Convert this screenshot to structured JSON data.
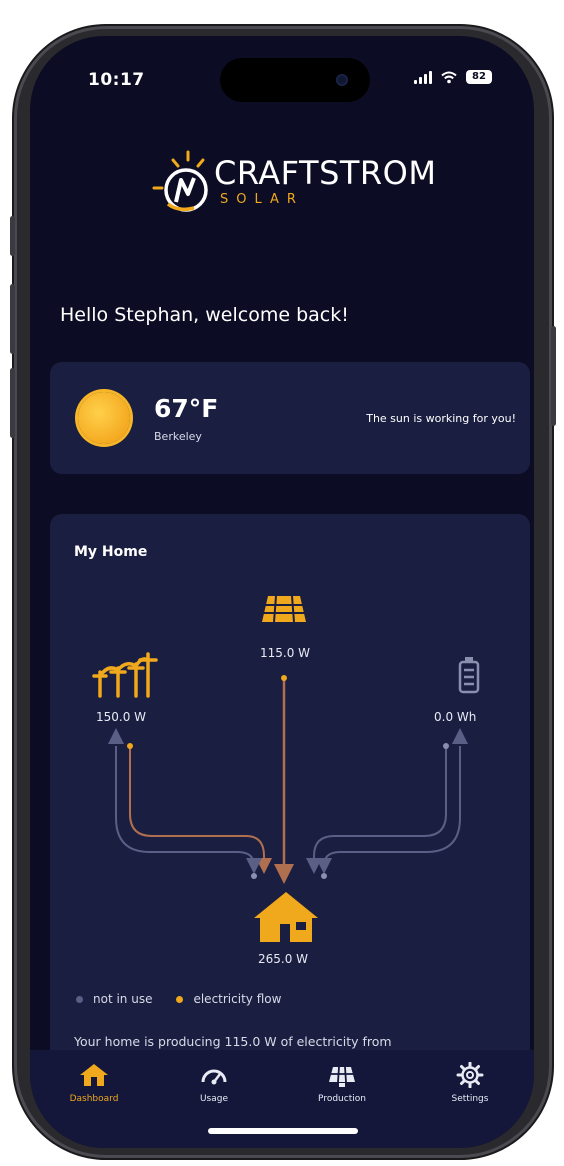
{
  "status_bar": {
    "time": "10:17",
    "battery": "82"
  },
  "logo": {
    "name": "CRAFTSTROM",
    "sub": "SOLAR"
  },
  "greeting": "Hello Stephan, welcome back!",
  "weather": {
    "temperature": "67°F",
    "city": "Berkeley",
    "message": "The sun is working for you!"
  },
  "home": {
    "title": "My Home",
    "solar_value": "115.0 W",
    "grid_value": "150.0 W",
    "battery_value": "0.0 Wh",
    "home_value": "265.0 W"
  },
  "legend": {
    "not_in_use": "not in use",
    "electricity_flow": "electricity flow"
  },
  "summary": "Your home is producing  115.0 W of electricity from",
  "tabs": [
    {
      "label": "Dashboard",
      "icon": "home-icon",
      "active": true
    },
    {
      "label": "Usage",
      "icon": "gauge-icon",
      "active": false
    },
    {
      "label": "Production",
      "icon": "solar-panel-icon",
      "active": false
    },
    {
      "label": "Settings",
      "icon": "gear-icon",
      "active": false
    }
  ],
  "colors": {
    "accent": "#f0a81c",
    "background": "#0c0d24",
    "card": "#1a1e40",
    "flow_active": "#b07050",
    "flow_inactive": "#5a5f86"
  }
}
